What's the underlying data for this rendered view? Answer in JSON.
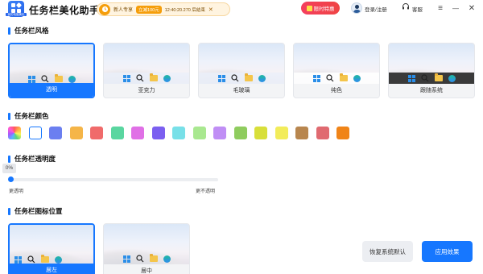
{
  "app": {
    "title": "任务栏美化助手",
    "logo_caption": "我的电脑美化"
  },
  "promo": {
    "text": "新人专享",
    "badge": "立减100元",
    "timer": "12:40:20.270 后结束",
    "close": "✕"
  },
  "header": {
    "limited_offer": "限时特惠",
    "login": "登录/注册",
    "service": "客服"
  },
  "window_controls": {
    "menu": "≡",
    "minimize": "—",
    "close": "✕"
  },
  "sections": {
    "style": {
      "title": "任务栏风格"
    },
    "color": {
      "title": "任务栏颜色"
    },
    "transparency": {
      "title": "任务栏透明度"
    },
    "position": {
      "title": "任务栏图标位置"
    }
  },
  "styles": [
    {
      "label": "透明",
      "selected": true,
      "bar": "transparent"
    },
    {
      "label": "亚克力",
      "selected": false,
      "bar": "glass"
    },
    {
      "label": "毛玻璃",
      "selected": false,
      "bar": "glass"
    },
    {
      "label": "纯色",
      "selected": false,
      "bar": "light"
    },
    {
      "label": "跟随系统",
      "selected": false,
      "bar": "dark"
    }
  ],
  "colors": [
    {
      "name": "gradient",
      "value": "conic"
    },
    {
      "name": "white",
      "value": "#ffffff",
      "selected": true
    },
    {
      "name": "blue",
      "value": "#6b7ff0"
    },
    {
      "name": "orange",
      "value": "#f5b548"
    },
    {
      "name": "red",
      "value": "#f06b6b"
    },
    {
      "name": "green",
      "value": "#5ad6a0"
    },
    {
      "name": "magenta",
      "value": "#e070e6"
    },
    {
      "name": "purple",
      "value": "#7b5ff0"
    },
    {
      "name": "cyan",
      "value": "#78e0e8"
    },
    {
      "name": "light-green",
      "value": "#a9e890"
    },
    {
      "name": "lavender",
      "value": "#c08ef5"
    },
    {
      "name": "grass",
      "value": "#8fcc5e"
    },
    {
      "name": "yellow-green",
      "value": "#d8df3a"
    },
    {
      "name": "yellow",
      "value": "#f2ec5a"
    },
    {
      "name": "brown",
      "value": "#b8864e"
    },
    {
      "name": "rose",
      "value": "#e06a70"
    },
    {
      "name": "deep-orange",
      "value": "#f08418"
    }
  ],
  "transparency": {
    "value_label": "0%",
    "value": 0,
    "min_label": "更透明",
    "max_label": "更不透明"
  },
  "positions": [
    {
      "label": "居左",
      "selected": true
    },
    {
      "label": "居中",
      "selected": false
    }
  ],
  "actions": {
    "reset": "恢复系统默认",
    "apply": "应用效果"
  }
}
